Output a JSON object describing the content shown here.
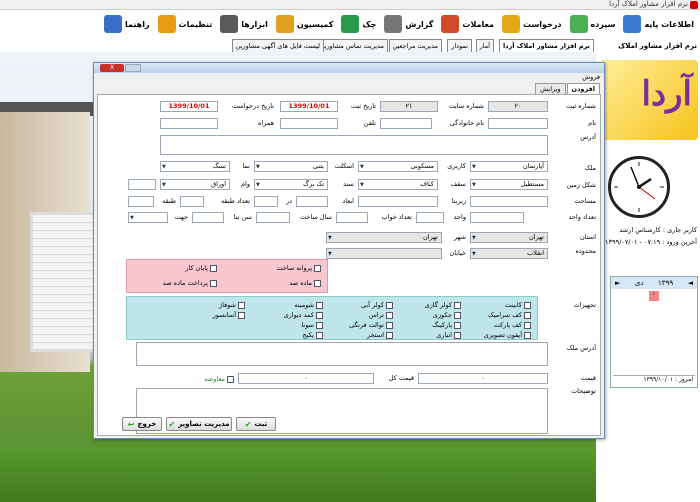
{
  "window": {
    "title": "نرم افزار مشاور املاک آردا"
  },
  "toolbar": [
    {
      "label": "اطلاعات پایه",
      "icon": "table-icon",
      "color": "#3a7bd5"
    },
    {
      "label": "سپرده",
      "icon": "add-folder-icon",
      "color": "#4caf50"
    },
    {
      "label": "درخواست",
      "icon": "folder-icon",
      "color": "#e6a817"
    },
    {
      "label": "معاملات",
      "icon": "pen-icon",
      "color": "#d04a2a"
    },
    {
      "label": "گزارش",
      "icon": "magnifier-icon",
      "color": "#777"
    },
    {
      "label": "چک",
      "icon": "check-icon",
      "color": "#2a9a4a"
    },
    {
      "label": "کمیسیون",
      "icon": "money-icon",
      "color": "#e0a020"
    },
    {
      "label": "ابزارها",
      "icon": "tools-icon",
      "color": "#5a5a5a"
    },
    {
      "label": "تنظیمات",
      "icon": "gear-icon",
      "color": "#e89a10"
    },
    {
      "label": "راهنما",
      "icon": "help-icon",
      "color": "#3a6ec8"
    }
  ],
  "app_tabs": [
    {
      "label": "نرم افزار مشاور املاک آردا",
      "active": true
    },
    {
      "label": "آمار"
    },
    {
      "label": "نمودار"
    },
    {
      "label": "مدیریت مراجعین"
    },
    {
      "label": "مدیریت تماس مشاورین"
    },
    {
      "label": "لیست فایل های آگهی مشاورین"
    }
  ],
  "side": {
    "title": "نرم افزار مشاور املاک",
    "logo_text": "آردا",
    "user_label": "کاربر جاری : کارشناس ارشد",
    "login_label": "آخرین ورود : ۰۷:۱۹ - ۱۳۹۹/۰۷/۰۱",
    "calendar": {
      "year": "۱۳۹۹",
      "month": "دی",
      "today": "امروز : ۱۳۹۹/۱۰/۰۱",
      "selected": "۱"
    }
  },
  "dialog": {
    "caption": "فروش",
    "close_label": "X",
    "tabs": [
      {
        "label": "افزودن",
        "active": true
      },
      {
        "label": "ویرایش"
      }
    ],
    "fields": {
      "reg_no_label": "شماره ثبت",
      "reg_no": "۲۰",
      "site_no_label": "شماره سایت",
      "site_no": "۲۱",
      "reg_date_label": "تاریخ ثبت",
      "reg_date": "1399/10/01",
      "req_date_label": "تاریخ درخواست",
      "req_date": "1399/10/01",
      "name_label": "نام",
      "family_label": "نام خانوادگی",
      "phone_label": "تلفن",
      "mobile_label": "همراه",
      "address_label": "آدرس",
      "property_label": "ملک",
      "property_value": "آپارتمان",
      "usage_label": "کاربری",
      "usage_value": "مسکونی",
      "skeleton_label": "اسکلت",
      "skeleton_value": "بتنی",
      "facade_label": "نما",
      "facade_value": "سنگ",
      "land_label": "شکل زمین",
      "land_value": "مستطیل",
      "ceiling_label": "سقف",
      "ceiling_value": "کناف",
      "doc_label": "سند",
      "doc_value": "تک برگ",
      "loan_label": "وام",
      "loan_value": "اوراق",
      "area_label": "مساحت",
      "infra_label": "زیربنا",
      "dims_label": "ابعاد",
      "by_label": "در",
      "floors_label": "تعداد طبقه",
      "floor_label": "طبقه",
      "units_label": "تعداد واحد",
      "unit_label": "واحد",
      "beds_label": "تعداد خواب",
      "built_year_label": "سال ساخت",
      "age_label": "سن بنا",
      "direction_label": "جهت",
      "province_label": "استان",
      "province_value": "تهران",
      "city_label": "شهر",
      "city_value": "تهران",
      "district_label": "محدوده",
      "district_value": "انقلاب",
      "street_label": "خیابان",
      "equip_label": "تجهیزات",
      "prop_addr_label": "آدرس ملک",
      "price_label": "قیمت",
      "price_value": "۰",
      "total_label": "قیمت کل",
      "total_value": "۰",
      "exchange_label": "معاوضه",
      "notes_label": "توضیحات"
    },
    "pink_checks": [
      {
        "label": "پروانه ساخت"
      },
      {
        "label": "پایان کار"
      },
      {
        "label": "ماده صد"
      },
      {
        "label": "پرداخت ماده صد"
      }
    ],
    "equipment": [
      [
        "کابینت",
        "کولر گازی",
        "کولر آبی",
        "شومینه",
        "شوفاژ"
      ],
      [
        "کف سرامیک",
        "جکوزی",
        "تراس",
        "کمد دیواری",
        "آسانسور"
      ],
      [
        "کف پارکت",
        "پارکینگ",
        "توالت فرنگی",
        "سونا"
      ],
      [
        "آیفون تصویری",
        "انباری",
        "استخر",
        "پکیج"
      ]
    ],
    "buttons": {
      "save": "ثبت",
      "images": "مدیریت تصاویر",
      "exit": "خروج"
    }
  }
}
